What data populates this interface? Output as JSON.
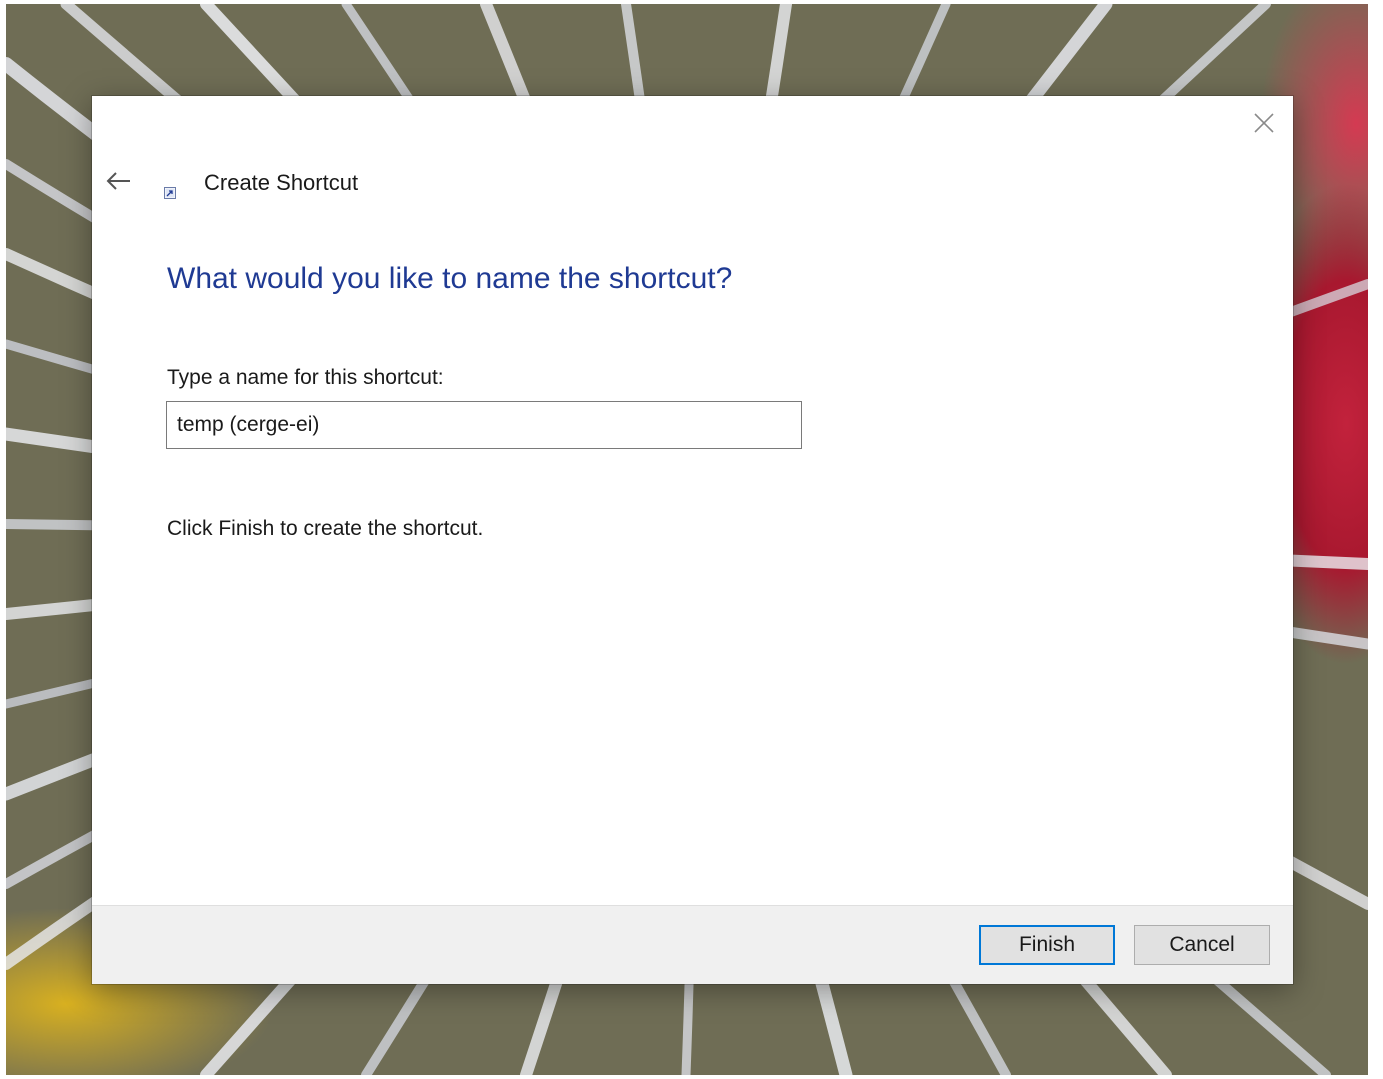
{
  "wizard": {
    "title": "Create Shortcut",
    "heading": "What would you like to name the shortcut?",
    "name_label": "Type a name for this shortcut:",
    "name_value": "temp (cerge-ei)",
    "instruction": "Click Finish to create the shortcut."
  },
  "buttons": {
    "finish": "Finish",
    "cancel": "Cancel"
  },
  "icons": {
    "close": "close-icon",
    "back": "back-arrow-icon",
    "wizard": "shortcut-icon"
  },
  "colors": {
    "heading": "#1f3a93",
    "focus_border": "#0078d7",
    "footer_bg": "#f0f0f0"
  }
}
